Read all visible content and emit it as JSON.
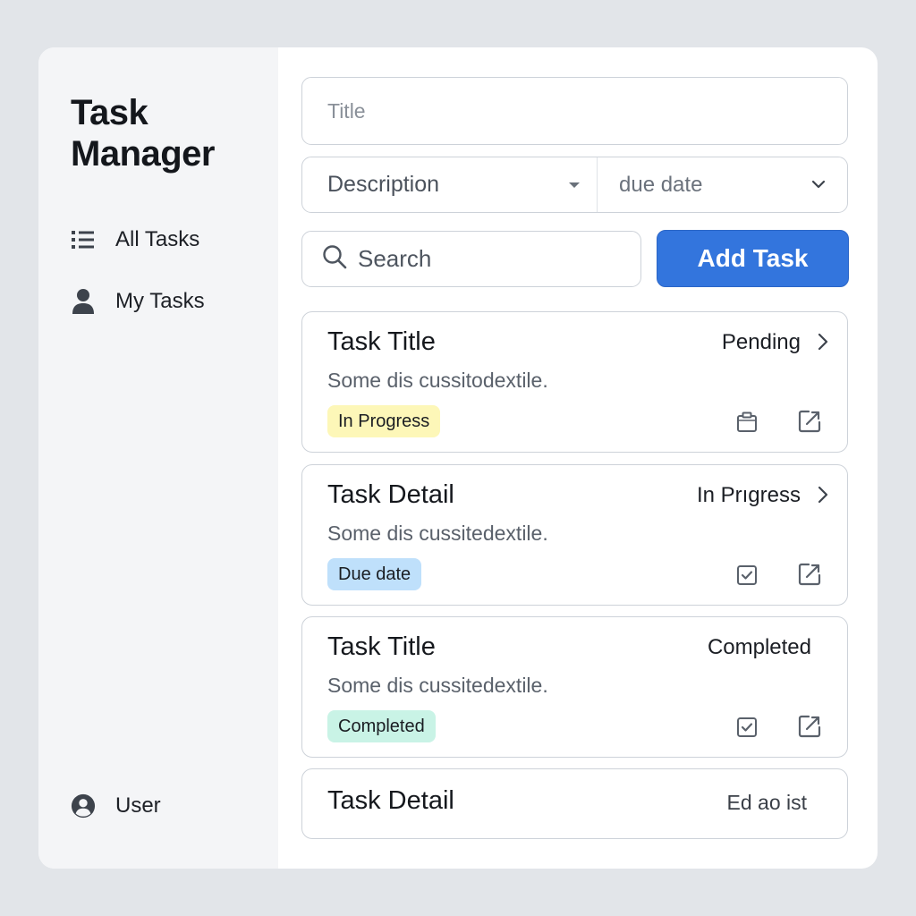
{
  "app": {
    "title_line1": "Task",
    "title_line2": "Manager"
  },
  "sidebar": {
    "items": [
      {
        "label": "All Tasks",
        "icon": "list-icon"
      },
      {
        "label": "My Tasks",
        "icon": "person-icon"
      }
    ],
    "user": {
      "label": "User",
      "icon": "user-avatar-icon"
    }
  },
  "form": {
    "title_placeholder": "Title",
    "description_label": "Description",
    "due_date_label": "due date",
    "search_placeholder": "Search",
    "add_button_label": "Add Task"
  },
  "tasks": [
    {
      "title": "Task Title",
      "status": "Pending",
      "description": "Some dis cussitodextile.",
      "badge": "In Progress",
      "badge_color": "#fdf7b8",
      "action_icon": "clipboard-icon",
      "has_chevron": true
    },
    {
      "title": "Task Detail",
      "status": "In Prıgress",
      "description": "Some dis cussitedextile.",
      "badge": "Due date",
      "badge_color": "#bfe0fb",
      "action_icon": "checkbox-icon",
      "has_chevron": true
    },
    {
      "title": "Task Title",
      "status": "Completed",
      "description": "Some dis cussitedextile.",
      "badge": "Completed",
      "badge_color": "#c9f3e6",
      "action_icon": "checkbox-icon",
      "has_chevron": false
    },
    {
      "title": "Task Detail",
      "status": "Ed ao ist"
    }
  ],
  "colors": {
    "accent": "#3375dd",
    "sidebar_bg": "#f4f5f7",
    "page_bg": "#e2e5e9"
  }
}
